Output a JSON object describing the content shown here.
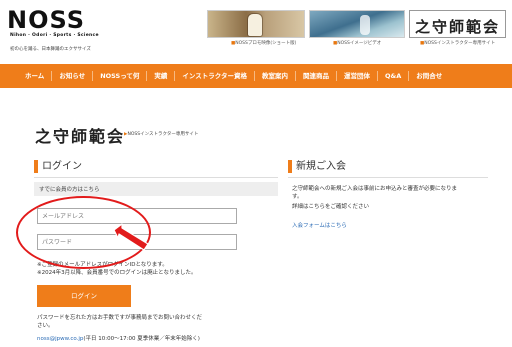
{
  "header": {
    "logo": "NOSS",
    "logo_sub": "Nihon · Odori · Sports · Science",
    "tagline": "初の心を踊る、日本舞踊のエクササイズ",
    "banners": [
      {
        "caption": "NOSSプロモ映像(ショート版)",
        "icon": "video-thumbnail"
      },
      {
        "caption": "NOSSイメージビデオ",
        "icon": "video-thumbnail"
      },
      {
        "caption": "NOSSインストラクター専用サイト",
        "text": "之守師範会"
      }
    ]
  },
  "nav": {
    "items": [
      "ホーム",
      "お知らせ",
      "NOSSって何",
      "実績",
      "インストラクター資格",
      "教室案内",
      "関連商品",
      "運営団体",
      "Q&A",
      "お問合せ"
    ]
  },
  "brand": {
    "title": "之守師範会",
    "subtitle": "NOSSインストラクター専用サイト"
  },
  "login": {
    "title": "ログイン",
    "already_member": "すでに会員の方はこちら",
    "email_placeholder": "メールアドレス",
    "password_placeholder": "パスワード",
    "note1": "※ご登録のメールアドレスがログインIDとなります。",
    "note2": "※2024年3月以降、会員番号でのログインは廃止となりました。",
    "button": "ログイン",
    "forgot1": "パスワードを忘れた方はお手数ですが事務局までお問い合わせくだ",
    "forgot2": "さい。",
    "contact_email": "noss@jpww.co.jp",
    "contact_hours": "(平日 10:00〜17:00 夏季休業／年末年始除く)"
  },
  "signup": {
    "title": "新規ご入会",
    "text1": "之守師範会への新規ご入会は事前にお申込みと審査が必要になりま",
    "text2": "す。",
    "text3": "詳細はこちらをご確認ください",
    "link": "入会フォームはこちら"
  },
  "colors": {
    "accent": "#ef7d1a",
    "annotation": "#e21b1b",
    "link": "#2a6bb5"
  }
}
